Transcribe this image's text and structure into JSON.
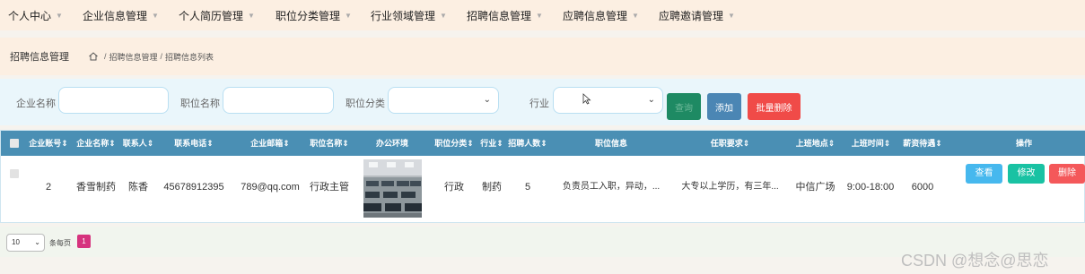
{
  "nav": {
    "items": [
      {
        "label": "个人中心"
      },
      {
        "label": "企业信息管理"
      },
      {
        "label": "个人简历管理"
      },
      {
        "label": "职位分类管理"
      },
      {
        "label": "行业领域管理"
      },
      {
        "label": "招聘信息管理"
      },
      {
        "label": "应聘信息管理"
      },
      {
        "label": "应聘邀请管理"
      }
    ],
    "caret": "▼"
  },
  "breadcrumb": {
    "title": "招聘信息管理",
    "sep": "/",
    "items": [
      "招聘信息管理",
      "招聘信息列表"
    ]
  },
  "search": {
    "company_label": "企业名称",
    "position_label": "职位名称",
    "category_label": "职位分类",
    "industry_label": "行业",
    "search_button": "查询",
    "add_button": "添加",
    "batch_delete_button": "批量删除",
    "select_caret": "⌄"
  },
  "table": {
    "headers": [
      "企业账号",
      "企业名称",
      "联系人",
      "联系电话",
      "企业邮箱",
      "职位名称",
      "办公环境",
      "职位分类",
      "行业",
      "招聘人数",
      "职位信息",
      "任职要求",
      "上班地点",
      "上班时间",
      "薪资待遇",
      "操作"
    ],
    "sort_mark": "⇕",
    "rows": [
      {
        "account": "2",
        "company": "香雪制药",
        "contact": "陈香",
        "phone": "45678912395",
        "email": "789@qq.com",
        "position": "行政主管",
        "category": "行政",
        "industry": "制药",
        "headcount": "5",
        "info": "负责员工入职，异动，...",
        "requirement": "大专以上学历，有三年...",
        "location": "中信广场",
        "hours": "9:00-18:00",
        "salary": "6000",
        "actions": {
          "view": "查看",
          "edit": "修改",
          "delete": "删除"
        }
      }
    ]
  },
  "pager": {
    "page_size": "10",
    "per_page_label": "条每页",
    "current_page": "1"
  },
  "watermark": "CSDN @想念@思恋",
  "colors": {
    "header_bg": "#4a8fb4",
    "search_btn": "#1e8a63",
    "add_btn": "#4b86b4",
    "batch_delete_btn": "#f04b48",
    "view_btn": "#46b8ee",
    "edit_btn": "#19c2a3",
    "delete_btn": "#f4585a",
    "page_active": "#d6337e"
  }
}
